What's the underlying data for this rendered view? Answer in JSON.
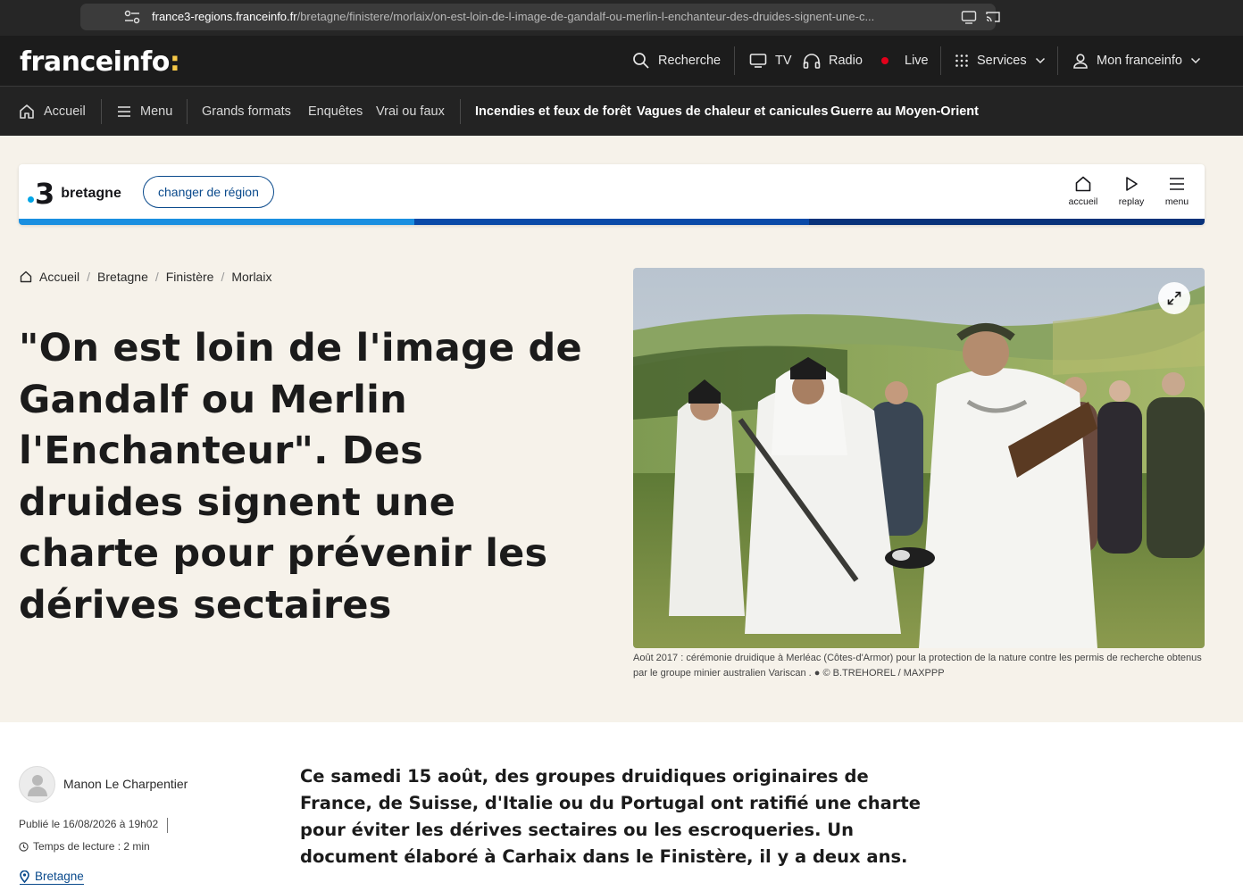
{
  "browser": {
    "url_host": "france3-regions.franceinfo.fr",
    "url_path": "/bretagne/finistere/morlaix/on-est-loin-de-l-image-de-gandalf-ou-merlin-l-enchanteur-des-druides-signent-une-c..."
  },
  "header": {
    "logo": "franceinfo",
    "logo_colon": ":",
    "search_label": "Recherche",
    "tv_label": "TV",
    "radio_label": "Radio",
    "live_label": "Live",
    "services_label": "Services",
    "account_label": "Mon franceinfo"
  },
  "nav": {
    "home_label": "Accueil",
    "menu_label": "Menu",
    "links": [
      "Grands formats",
      "Enquêtes",
      "Vrai ou faux"
    ],
    "hot_topics": [
      "Incendies et feux de forêt",
      "Vagues de chaleur et canicules",
      "Guerre au Moyen-Orient"
    ]
  },
  "region": {
    "number": "3",
    "name": "bretagne",
    "change_label": "changer de région",
    "actions": [
      "accueil",
      "replay",
      "menu"
    ],
    "stripe_colors": [
      "#1a8fe0",
      "#0a4aa8",
      "#08327a"
    ]
  },
  "breadcrumb": [
    "Accueil",
    "Bretagne",
    "Finistère",
    "Morlaix"
  ],
  "article": {
    "title": "\"On est loin de l'image de Gandalf ou Merlin l'Enchanteur\". Des druides signent une charte pour prévenir les dérives sectaires",
    "caption": "Août 2017 : cérémonie druidique à Merléac (Côtes-d'Armor) pour la protection de la nature contre les permis de recherche obtenus par le groupe minier australien Variscan . ● © B.TREHOREL / MAXPPP",
    "author": "Manon Le Charpentier",
    "published": "Publié le 16/08/2026 à 19h02",
    "reading_time": "Temps de lecture : 2 min",
    "tag": "Bretagne",
    "chapo": "Ce samedi 15 août, des groupes druidiques originaires de France, de Suisse, d'Italie ou du Portugal ont ratifié une charte pour éviter les dérives sectaires ou les escroqueries. Un document élaboré à Carhaix dans le Finistère, il y a deux ans."
  },
  "colors": {
    "header_bg": "#1c1c1c",
    "hero_bg": "#f6f2ea",
    "accent_link": "#0a4a8c",
    "live_red": "#e2001a",
    "logo_yellow": "#f7c948"
  },
  "icons": [
    "bookmark-icon",
    "site-info-icon",
    "install-icon",
    "cast-icon",
    "search-icon",
    "tv-icon",
    "headphones-icon",
    "grid-icon",
    "chevron-down-icon",
    "user-icon",
    "home-icon",
    "hamburger-icon",
    "play-icon",
    "expand-icon",
    "clock-icon",
    "location-pin-icon"
  ]
}
